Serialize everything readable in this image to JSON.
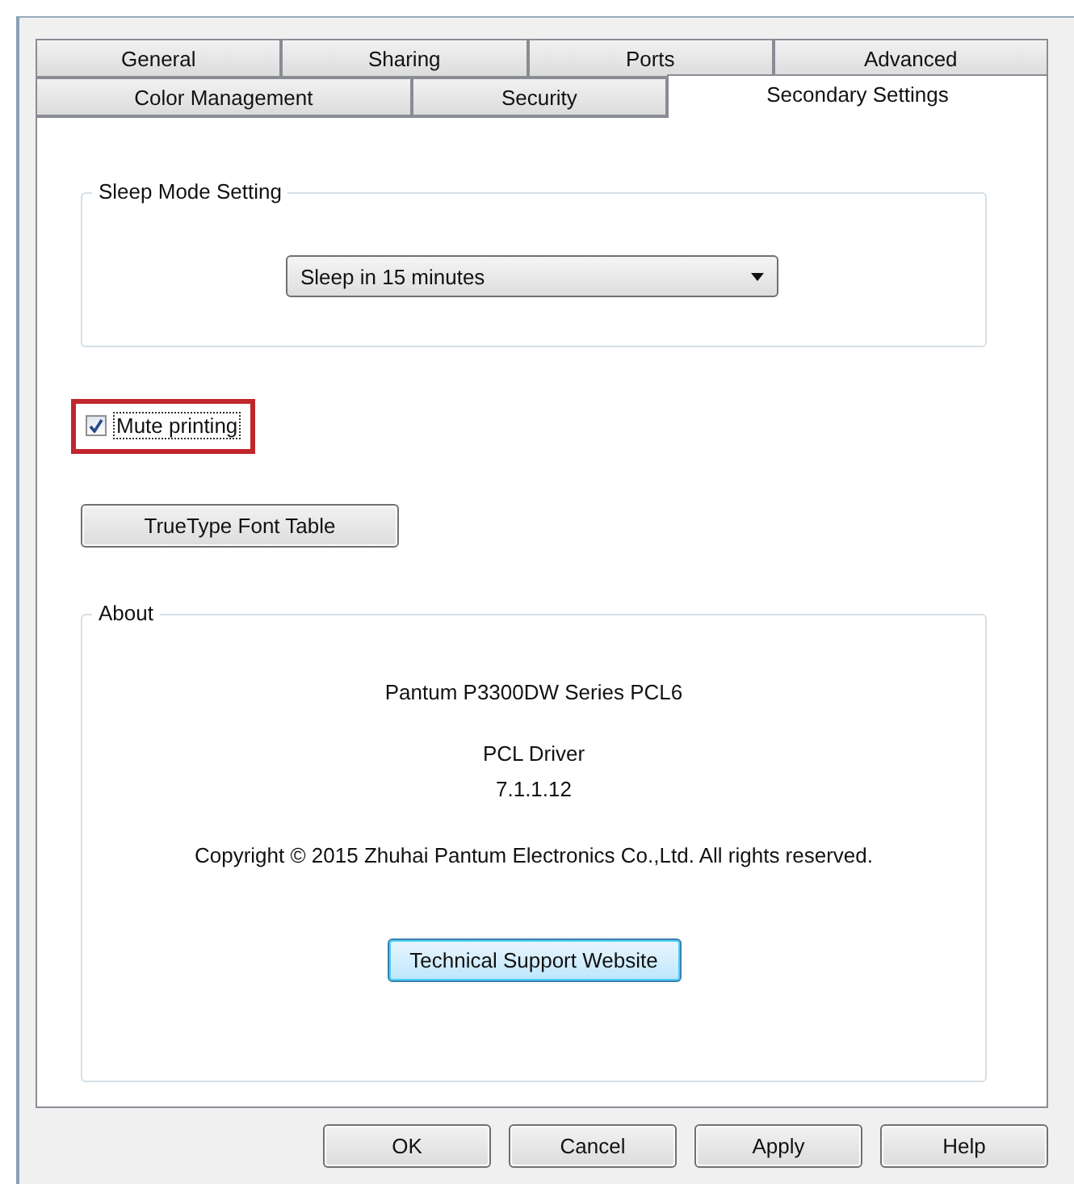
{
  "tabs": [
    [
      {
        "label": "General",
        "selected": false
      },
      {
        "label": "Sharing",
        "selected": false
      },
      {
        "label": "Ports",
        "selected": false
      },
      {
        "label": "Advanced",
        "selected": false
      }
    ],
    [
      {
        "label": "Color Management",
        "selected": false
      },
      {
        "label": "Security",
        "selected": false
      },
      {
        "label": "Secondary Settings",
        "selected": true
      }
    ]
  ],
  "sleep_group": {
    "title": "Sleep Mode Setting",
    "dropdown": "Sleep in 15 minutes"
  },
  "mute_checkbox": {
    "label": "Mute printing",
    "checked": true,
    "highlighted": true
  },
  "font_table_button": "TrueType Font Table",
  "about": {
    "title": "About",
    "product": "Pantum P3300DW Series PCL6",
    "driver": "PCL Driver",
    "version": "7.1.1.12",
    "copyright": "Copyright © 2015 Zhuhai Pantum Electronics Co.,Ltd. All rights reserved.",
    "support_button": {
      "label": "Technical Support Website",
      "focused": true
    }
  },
  "buttons": [
    "OK",
    "Cancel",
    "Apply",
    "Help"
  ]
}
